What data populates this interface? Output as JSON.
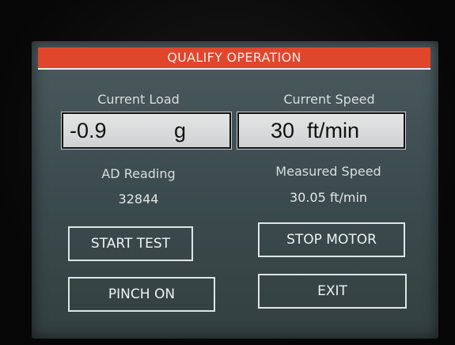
{
  "title": "QUALIFY OPERATION",
  "current_load": {
    "label": "Current Load",
    "value": "-0.9",
    "unit": "g"
  },
  "current_speed": {
    "label": "Current Speed",
    "value": "30",
    "unit": "ft/min"
  },
  "ad_reading": {
    "label": "AD Reading",
    "value": "32844"
  },
  "measured_speed": {
    "label": "Measured Speed",
    "value": "30.05 ft/min"
  },
  "buttons": {
    "start_test": "START TEST",
    "stop_motor": "STOP MOTOR",
    "pinch_on": "PINCH ON",
    "exit": "EXIT"
  },
  "colors": {
    "title_bar": "#e0462c",
    "screen_bg": "#3c4b4f",
    "box_bg": "#dcdfdf"
  }
}
